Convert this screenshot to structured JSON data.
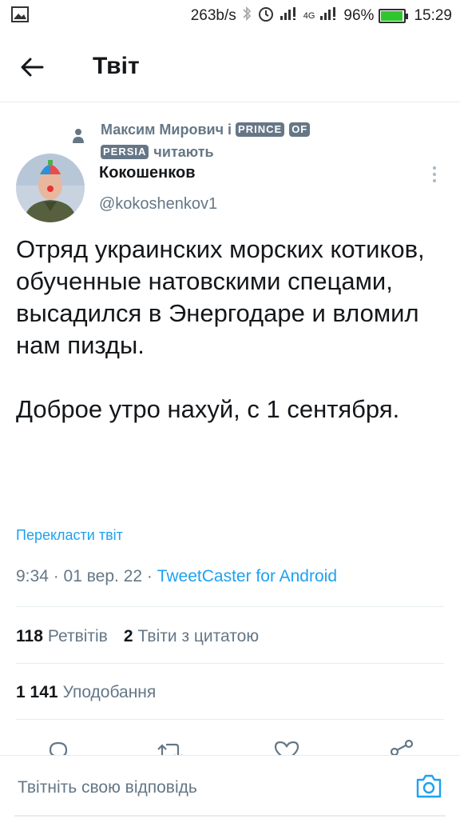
{
  "status_bar": {
    "net_speed": "263b/s",
    "network": "4G",
    "battery": "96%",
    "time": "15:29",
    "battery_level": 0.96,
    "battery_color": "#2ec62e"
  },
  "header": {
    "title": "Твіт"
  },
  "social_context": {
    "name": "Максим Мирович і",
    "boxed_words": [
      "PRINCE",
      "OF",
      "PERSIA"
    ],
    "suffix": "читають"
  },
  "author": {
    "name": "Кокошенков",
    "handle": "@kokoshenkov1"
  },
  "tweet": {
    "paragraphs": [
      "Отряд украинских морских котиков, обученные натовскими спецами, высадился в Энергодаре и вломил нам пизды.",
      "Доброе утро нахуй, с 1 сентября."
    ],
    "translate_label": "Перекласти твіт",
    "time": "9:34",
    "date": "01 вер. 22",
    "source": "TweetCaster for Android"
  },
  "stats": {
    "retweets_count": "118",
    "retweets_label": "Ретвітів",
    "quotes_count": "2",
    "quotes_label": "Твіти з цитатою",
    "likes_count": "1 141",
    "likes_label": "Уподобання"
  },
  "actions": [
    "reply-icon",
    "retweet-icon",
    "like-icon",
    "share-icon"
  ],
  "reply_bar": {
    "placeholder": "Твітніть свою відповідь"
  },
  "colors": {
    "accent": "#1da1f2",
    "secondary_text": "#657786",
    "primary_text": "#14171a",
    "divider": "#e6ecf0"
  }
}
